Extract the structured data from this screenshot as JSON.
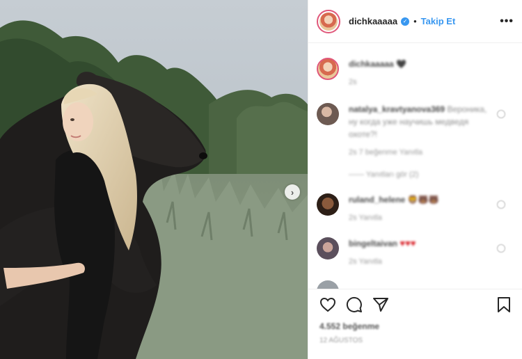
{
  "post": {
    "author": "dichkaaaaa",
    "follow_label": "Takip Et",
    "separator": "•",
    "more_label": "•••",
    "next_label": "›"
  },
  "comments": [
    {
      "name": "dichkaaaaa",
      "text": "🖤",
      "meta": "2s"
    },
    {
      "name": "natalya_kravtyanova369",
      "text": "Вероника, ну когда уже научишь медведя охоте?!",
      "meta": "2s   7 beğenme   Yanıtla",
      "replies": "——  Yanıtları gör (2)"
    },
    {
      "name": "ruland_helene",
      "text": "🦁🐻🐻",
      "meta": "2s   Yanıtla"
    },
    {
      "name": "bingeltaivan",
      "text": "♥♥♥",
      "meta": "2s   Yanıtla"
    }
  ],
  "footer": {
    "likes": "4.552 beğenme",
    "time": "12 AĞUSTOS"
  },
  "colors": {
    "accent": "#3897f0",
    "text": "#262626",
    "muted": "#8e8e8e",
    "heart": "#d81f26"
  }
}
